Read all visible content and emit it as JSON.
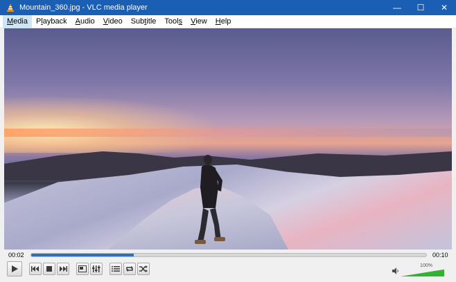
{
  "window": {
    "title": "Mountain_360.jpg - VLC media player",
    "minimize_glyph": "—",
    "maximize_glyph": "☐",
    "close_glyph": "✕"
  },
  "menu": [
    {
      "name": "menu-media",
      "pre": "",
      "ul": "M",
      "post": "edia"
    },
    {
      "name": "menu-playback",
      "pre": "P",
      "ul": "l",
      "post": "ayback"
    },
    {
      "name": "menu-audio",
      "pre": "",
      "ul": "A",
      "post": "udio"
    },
    {
      "name": "menu-video",
      "pre": "",
      "ul": "V",
      "post": "ideo"
    },
    {
      "name": "menu-subtitle",
      "pre": "Sub",
      "ul": "t",
      "post": "itle"
    },
    {
      "name": "menu-tools",
      "pre": "Tool",
      "ul": "s",
      "post": ""
    },
    {
      "name": "menu-view",
      "pre": "",
      "ul": "V",
      "post": "iew"
    },
    {
      "name": "menu-help",
      "pre": "",
      "ul": "H",
      "post": "elp"
    }
  ],
  "playback": {
    "current_time": "00:02",
    "total_time": "00:10",
    "progress_fraction": 0.26
  },
  "volume": {
    "percent_label": "100%",
    "level_fraction": 1.0
  },
  "colors": {
    "titlebar": "#1a5fb4",
    "seek_fill": "#2e6fb7",
    "volume_fill": "#2db52d"
  },
  "icons": {
    "app": "vlc-cone-icon",
    "play": "play-icon",
    "prev": "previous-icon",
    "stop": "stop-icon",
    "next": "next-icon",
    "fullscreen": "fullscreen-icon",
    "extended": "extended-settings-icon",
    "playlist": "playlist-icon",
    "loop": "loop-icon",
    "random": "shuffle-icon",
    "speaker": "speaker-icon"
  }
}
